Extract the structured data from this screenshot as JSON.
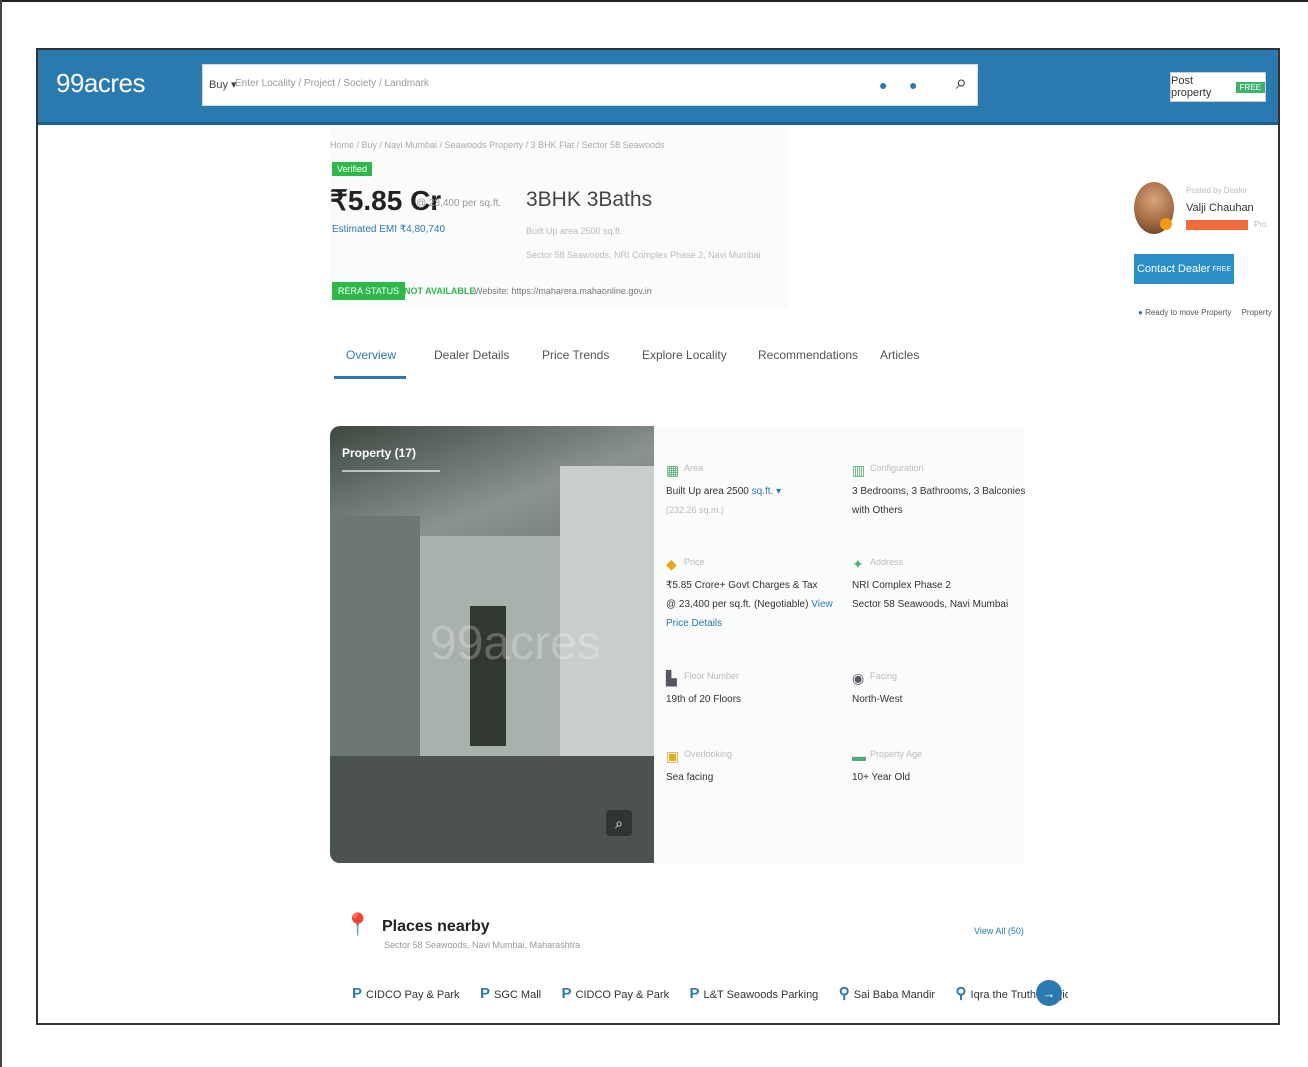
{
  "header": {
    "logo": "99acres",
    "search": {
      "buy_label": "Buy ▾",
      "placeholder": "Enter Locality / Project / Society / Landmark"
    },
    "post_property": {
      "label": "Post property",
      "badge": "FREE"
    }
  },
  "summary": {
    "breadcrumb": "Home / Buy / Navi Mumbai / Seawoods Property / 3 BHK Flat / Sector 58 Seawoods",
    "verified_badge": "Verified",
    "price": "₹5.85 Cr",
    "price_per_sqft": "@ 23,400 per sq.ft.",
    "config": "3BHK 3Baths",
    "emi": "Estimated EMI ₹4,80,740",
    "meta_line1": "Built Up area 2500 sq.ft.",
    "meta_line2": "Sector 58 Seawoods, NRI Complex Phase 2, Navi Mumbai",
    "rera_badge": "RERA STATUS",
    "rera_status": "NOT AVAILABLE",
    "rera_note": "Website: https://maharera.mahaonline.gov.in"
  },
  "tabs": [
    "Overview",
    "Dealer Details",
    "Price Trends",
    "Explore Locality",
    "Recommendations",
    "Articles"
  ],
  "gallery": {
    "label": "Property (17)",
    "watermark": "99acres"
  },
  "details": {
    "area": {
      "label": "Area",
      "value": "Built Up area 2500",
      "unit": "sq.ft. ▾",
      "sub": "(232.26 sq.m.)"
    },
    "configuration": {
      "label": "Configuration",
      "value": "3 Bedrooms, 3 Bathrooms, 3 Balconies with Others"
    },
    "price": {
      "label": "Price",
      "value": "₹5.85 Crore+ Govt Charges & Tax",
      "psf": "@ 23,400 per sq.ft. (Negotiable)",
      "link": "View Price Details"
    },
    "address": {
      "label": "Address",
      "line1": "NRI Complex Phase 2",
      "line2": "Sector 58 Seawoods, Navi Mumbai"
    },
    "floor": {
      "label": "Floor Number",
      "value": "19th of 20 Floors"
    },
    "facing": {
      "label": "Facing",
      "value": "North-West"
    },
    "overlooking": {
      "label": "Overlooking",
      "value": "Sea facing"
    },
    "property_age": {
      "label": "Property Age",
      "value": "10+ Year Old"
    }
  },
  "places": {
    "title": "Places nearby",
    "subtitle": "Sector 58 Seawoods, Navi Mumbai, Maharashtra",
    "view_all": "View All (50)",
    "chips": [
      "CIDCO Pay & Park",
      "SGC Mall",
      "CIDCO Pay & Park",
      "L&T Seawoods Parking",
      "Sai Baba Mandir",
      "Iqra the Truth Masjid"
    ]
  },
  "dealer": {
    "intro": "Posted by Dealer",
    "name": "Valji Chauhan",
    "badge2": "Pro",
    "contact_label": "Contact Dealer",
    "contact_badge": "FREE",
    "ready_label": "Ready to move Property",
    "ready_more": "Property"
  },
  "colors": {
    "brand": "#2a7ab0",
    "green": "#2db84a",
    "orange": "#f26b3a"
  }
}
